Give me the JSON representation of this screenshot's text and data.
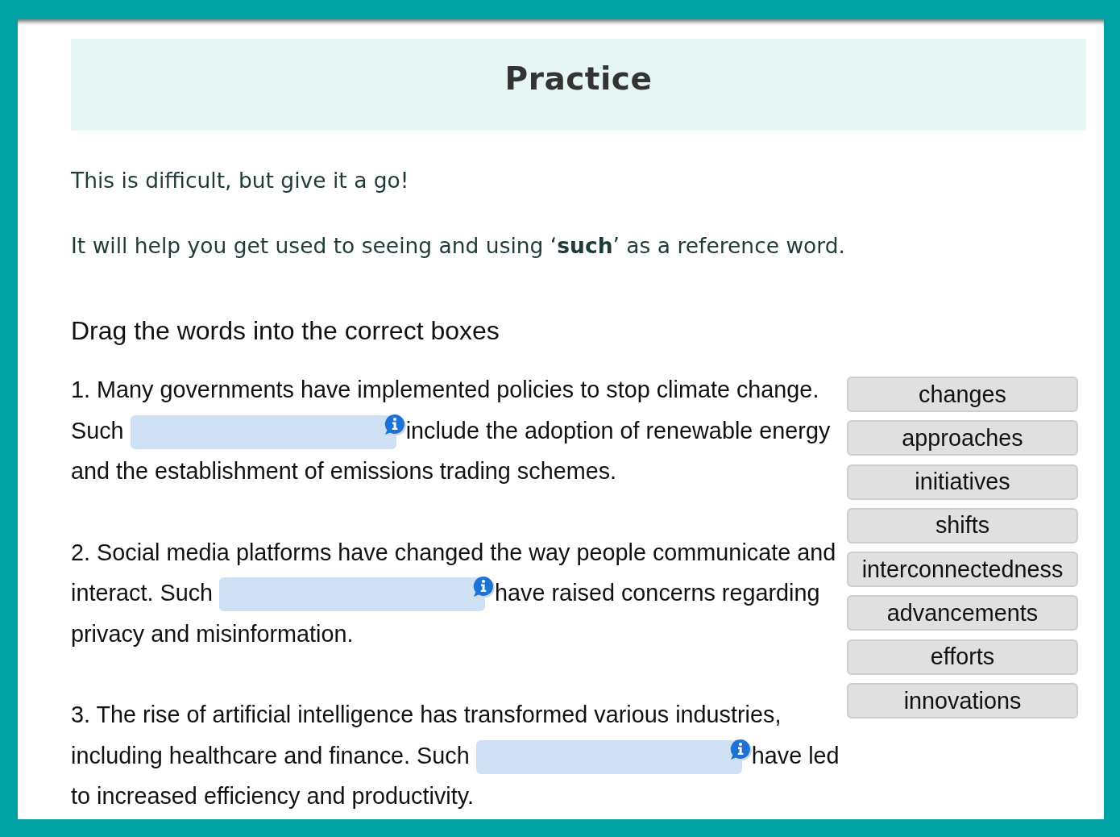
{
  "title": "Practice",
  "intro": [
    "This is difficult, but give it a go!",
    "It will help you get used to seeing and using ‘**such**’ as a reference word."
  ],
  "instruction": "Drag the words into the correct boxes",
  "questions": [
    {
      "before": "1. Many governments have implemented policies to stop climate change. Such",
      "after": "include the adoption of renewable energy and the establishment of emissions trading schemes."
    },
    {
      "before": "2. Social media platforms have changed the way people communicate and interact. Such",
      "after": "have raised concerns regarding privacy and misinformation."
    },
    {
      "before": "3. The rise of artificial intelligence has transformed various industries, including healthcare and finance. Such",
      "after": "have led to increased efficiency and productivity."
    }
  ],
  "word_bank": [
    "changes",
    "approaches",
    "initiatives",
    "shifts",
    "interconnectedness",
    "advancements",
    "efforts",
    "innovations"
  ]
}
